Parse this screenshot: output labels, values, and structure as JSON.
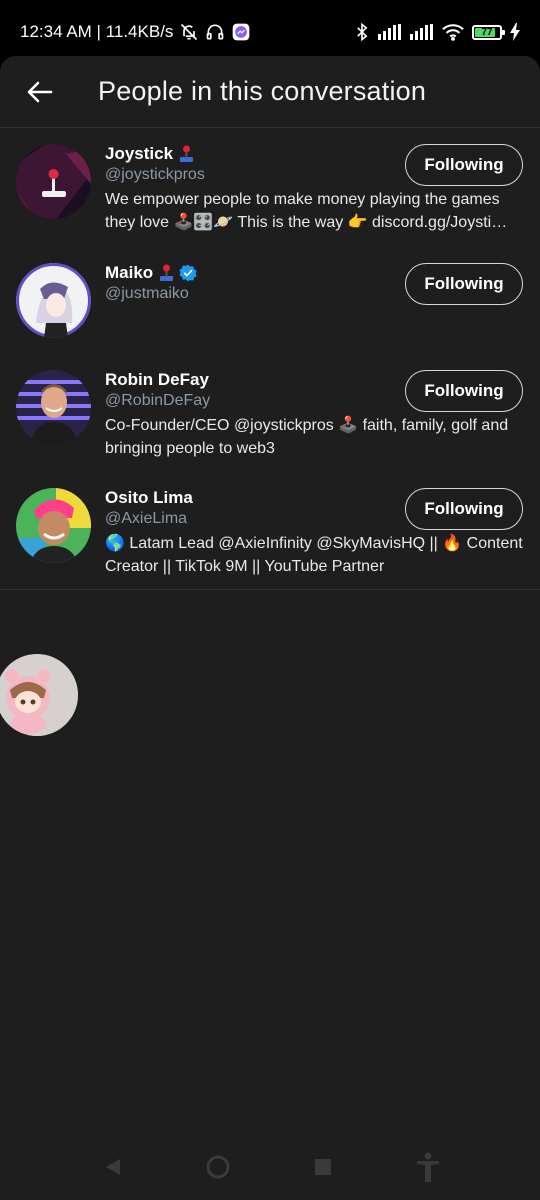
{
  "status_bar": {
    "time_info": "12:34 AM | 11.4KB/s",
    "battery": "77"
  },
  "header": {
    "title": "People in this conversation"
  },
  "users": [
    {
      "name": "Joystick",
      "handle": "@joystickpros",
      "bio": "We empower people to make money playing the games they love 🕹️🎛️🪐 This is the way 👉 discord.gg/Joysti…",
      "follow_label": "Following"
    },
    {
      "name": "Maiko",
      "handle": "@justmaiko",
      "bio": "",
      "follow_label": "Following"
    },
    {
      "name": "Robin DeFay",
      "handle": "@RobinDeFay",
      "bio": "Co-Founder/CEO @joystickpros 🕹️ faith, family, golf and bringing people to web3",
      "follow_label": "Following"
    },
    {
      "name": "Osito Lima",
      "handle": "@AxieLima",
      "bio": "🌎 Latam Lead @AxieInfinity @SkyMavisHQ || 🔥 Content Creator || TikTok 9M || YouTube Partner",
      "follow_label": "Following"
    }
  ],
  "colors": {
    "background": "#1e1e1e",
    "verified": "#1d9bf0",
    "handle": "#8b98a5"
  },
  "icons": [
    "back-arrow-icon",
    "bell-off-icon",
    "headset-icon",
    "messenger-icon",
    "bluetooth-icon",
    "signal-icon",
    "wifi-icon",
    "battery-icon",
    "charging-icon",
    "verified-icon",
    "nav-back-icon",
    "nav-home-icon",
    "nav-recents-icon",
    "accessibility-icon"
  ]
}
